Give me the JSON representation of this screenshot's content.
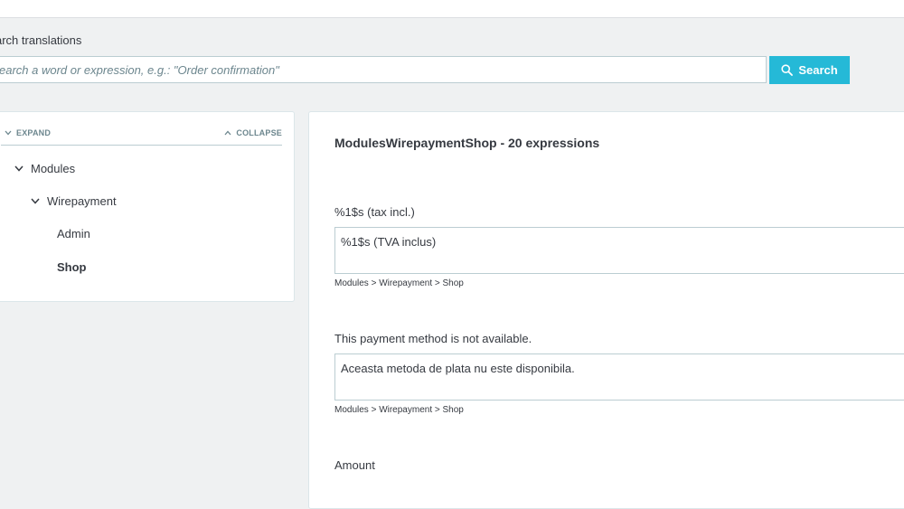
{
  "search": {
    "label": "arch translations",
    "placeholder": "earch a word or expression, e.g.: \"Order confirmation\"",
    "button_label": "Search"
  },
  "tree": {
    "expand_label": "EXPAND",
    "collapse_label": "COLLAPSE",
    "nodes": [
      {
        "label": "Modules",
        "expanded": true
      },
      {
        "label": "Wirepayment",
        "expanded": true
      },
      {
        "label": "Admin"
      },
      {
        "label": "Shop",
        "selected": true
      }
    ]
  },
  "main": {
    "title": "ModulesWirepaymentShop - 20 expressions",
    "expressions": [
      {
        "label": "%1$s (tax incl.)",
        "value": "%1$s (TVA inclus)",
        "path": "Modules > Wirepayment > Shop"
      },
      {
        "label": "This payment method is not available.",
        "value": "Aceasta metoda de plata nu este disponibila.",
        "path": "Modules > Wirepayment > Shop"
      },
      {
        "label": "Amount"
      }
    ]
  },
  "colors": {
    "accent": "#25b9d7",
    "background": "#eff1f2",
    "text": "#363a41",
    "muted": "#6c868e",
    "border": "#bbcdd2"
  }
}
